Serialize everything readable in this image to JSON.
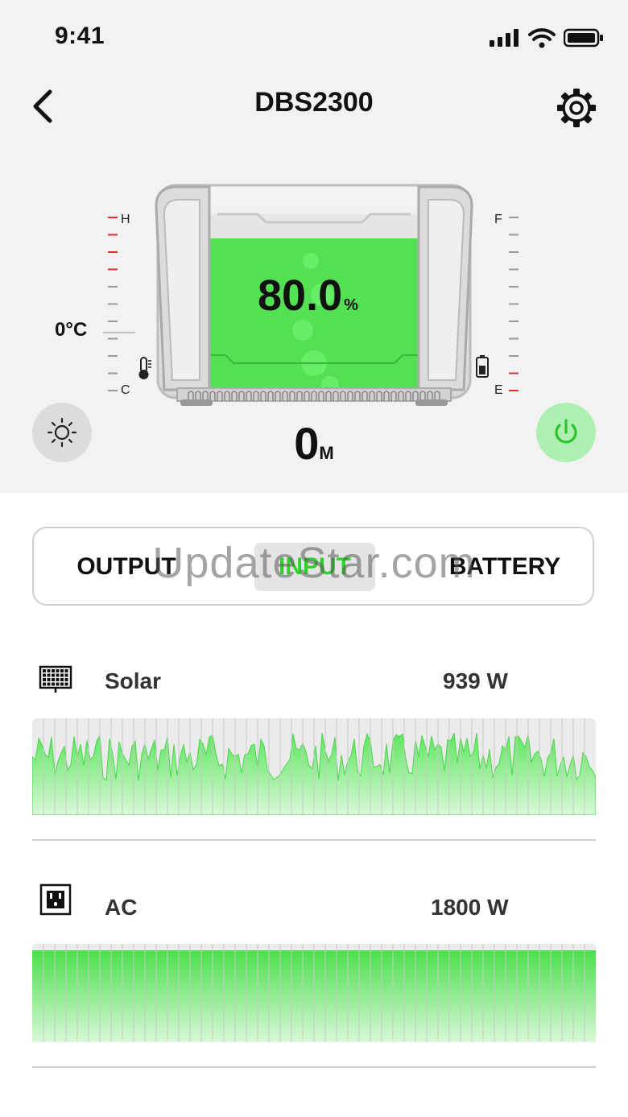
{
  "status_bar": {
    "time": "9:41"
  },
  "header": {
    "title": "DBS2300"
  },
  "device_panel": {
    "battery_percent": "80.0",
    "battery_percent_unit": "%",
    "battery_level": 0.8,
    "temperature": "0°C",
    "temp_gauge": {
      "high_label": "H",
      "low_label": "C"
    },
    "charge_gauge": {
      "full_label": "F",
      "empty_label": "E"
    },
    "remaining_time": {
      "value": "0",
      "unit": "M"
    },
    "accent_color": "#4be04b"
  },
  "tabs": [
    {
      "label": "OUTPUT",
      "active": false
    },
    {
      "label": "INPUT",
      "active": true
    },
    {
      "label": "BATTERY",
      "active": false
    }
  ],
  "watermark": "UpdateStar.com",
  "inputs": [
    {
      "name": "Solar",
      "value": "939 W",
      "icon": "solar-panel-icon"
    },
    {
      "name": "AC",
      "value": "1800 W",
      "icon": "ac-outlet-icon"
    }
  ]
}
